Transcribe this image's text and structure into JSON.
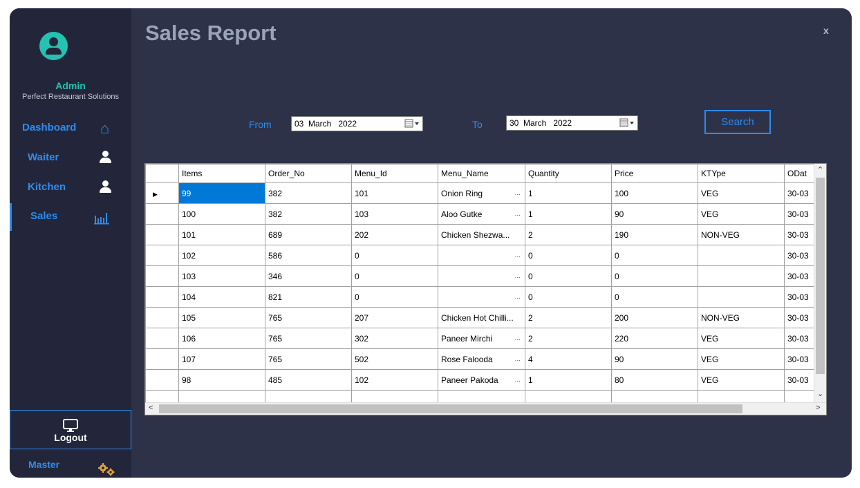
{
  "sidebar": {
    "admin_name": "Admin",
    "company": "Perfect Restaurant Solutions",
    "nav": [
      {
        "label": "Dashboard",
        "icon": "home-icon"
      },
      {
        "label": "Waiter",
        "icon": "person-icon"
      },
      {
        "label": "Kitchen",
        "icon": "person-icon"
      },
      {
        "label": "Sales",
        "icon": "bar-chart-icon"
      }
    ],
    "logout_label": "Logout",
    "master_label": "Master"
  },
  "header": {
    "title": "Sales Report",
    "close_label": "x"
  },
  "filter": {
    "from_label": "From",
    "from_date": "03  March   2022",
    "to_label": "To",
    "to_date": "30  March   2022",
    "search_label": "Search"
  },
  "table": {
    "columns": [
      "Items",
      "Order_No",
      "Menu_Id",
      "Menu_Name",
      "Quantity",
      "Price",
      "KTYpe",
      "ODat"
    ],
    "rows": [
      [
        "99",
        "382",
        "101",
        "Onion Ring",
        "1",
        "100",
        "VEG",
        "30-03"
      ],
      [
        "100",
        "382",
        "103",
        "Aloo Gutke",
        "1",
        "90",
        "VEG",
        "30-03"
      ],
      [
        "101",
        "689",
        "202",
        "Chicken Shezwa...",
        "2",
        "190",
        "NON-VEG",
        "30-03"
      ],
      [
        "102",
        "586",
        "0",
        "",
        "0",
        "0",
        "",
        "30-03"
      ],
      [
        "103",
        "346",
        "0",
        "",
        "0",
        "0",
        "",
        "30-03"
      ],
      [
        "104",
        "821",
        "0",
        "",
        "0",
        "0",
        "",
        "30-03"
      ],
      [
        "105",
        "765",
        "207",
        "Chicken Hot Chilli...",
        "2",
        "200",
        "NON-VEG",
        "30-03"
      ],
      [
        "106",
        "765",
        "302",
        "Paneer Mirchi",
        "2",
        "220",
        "VEG",
        "30-03"
      ],
      [
        "107",
        "765",
        "502",
        "Rose Falooda",
        "4",
        "90",
        "VEG",
        "30-03"
      ],
      [
        "98",
        "485",
        "102",
        "Paneer Pakoda",
        "1",
        "80",
        "VEG",
        "30-03"
      ]
    ],
    "ellipsis": "..."
  },
  "colors": {
    "accent": "#2d8cf0",
    "teal": "#25c2b2",
    "panel": "#2d3249",
    "sidebar": "#23263a",
    "selection": "#0078d7"
  }
}
